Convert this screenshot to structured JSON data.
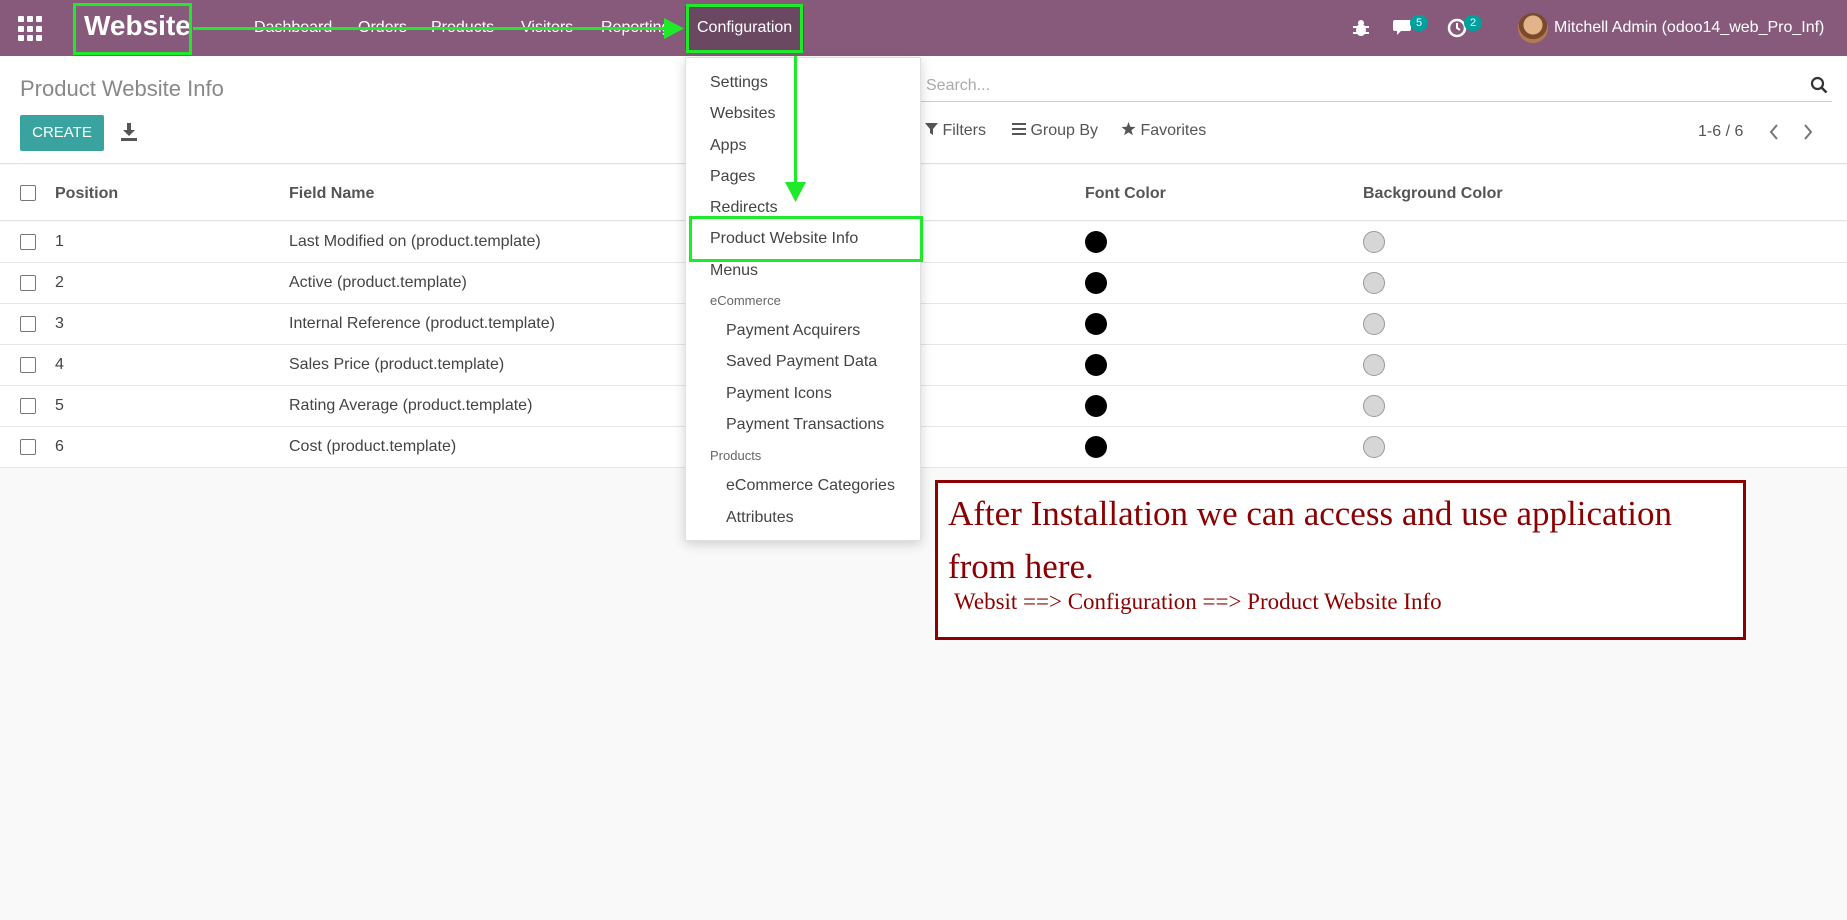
{
  "navbar": {
    "brand": "Website",
    "menu": [
      "Dashboard",
      "Orders",
      "Products",
      "Visitors",
      "Reporting",
      "Configuration"
    ],
    "messages_count": "5",
    "activities_count": "2",
    "user": "Mitchell Admin (odoo14_web_Pro_Inf)"
  },
  "control_panel": {
    "title": "Product Website Info",
    "create_label": "CREATE",
    "search_placeholder": "Search...",
    "filters_label": "Filters",
    "group_by_label": "Group By",
    "favorites_label": "Favorites",
    "pager": "1-6 / 6"
  },
  "table": {
    "columns": [
      "Position",
      "Field Name",
      "Font Color",
      "Background Color"
    ],
    "rows": [
      {
        "position": "1",
        "field": "Last Modified on (product.template)"
      },
      {
        "position": "2",
        "field": "Active (product.template)"
      },
      {
        "position": "3",
        "field": "Internal Reference (product.template)"
      },
      {
        "position": "4",
        "field": "Sales Price (product.template)"
      },
      {
        "position": "5",
        "field": "Rating Average (product.template)"
      },
      {
        "position": "6",
        "field": "Cost (product.template)"
      }
    ]
  },
  "dropdown": {
    "items": [
      "Settings",
      "Websites",
      "Apps",
      "Pages",
      "Redirects",
      "Product Website Info",
      "Menus"
    ],
    "ecommerce_header": "eCommerce",
    "ecommerce_items": [
      "Payment Acquirers",
      "Saved Payment Data",
      "Payment Icons",
      "Payment Transactions"
    ],
    "products_header": "Products",
    "products_items": [
      "eCommerce Categories",
      "Attributes"
    ]
  },
  "annotation": {
    "title": "After Installation we can access and use application from here.",
    "path": "Websit ==> Configuration ==> Product Website Info"
  },
  "colors": {
    "navbar": "#875a7b",
    "primary": "#3aa29f",
    "highlight": "#1eea2a",
    "note": "#8b0000"
  }
}
